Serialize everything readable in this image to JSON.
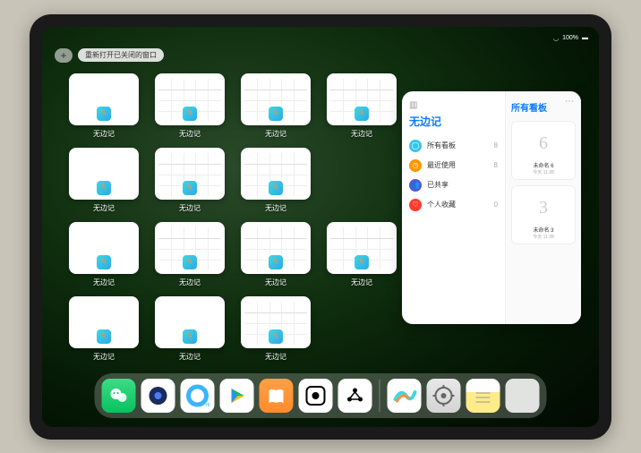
{
  "status": {
    "time": "",
    "battery": "100%",
    "wifi": "wifi"
  },
  "top": {
    "plus": "+",
    "reopen": "重新打开已关闭的窗口"
  },
  "windows": {
    "label": "无边记",
    "items": [
      {
        "style": "blank"
      },
      {
        "style": "cal"
      },
      {
        "style": "cal"
      },
      {
        "style": "cal"
      },
      {
        "style": "blank"
      },
      {
        "style": "cal"
      },
      {
        "style": "cal"
      },
      {
        "style": "blank"
      },
      {
        "style": "cal"
      },
      {
        "style": "cal"
      },
      {
        "style": "cal"
      },
      {
        "style": "blank"
      },
      {
        "style": "blank"
      },
      {
        "style": "cal"
      }
    ]
  },
  "panel": {
    "title": "无边记",
    "items": [
      {
        "icon": "ic-blue",
        "glyph": "◯",
        "label": "所有看板",
        "count": "8"
      },
      {
        "icon": "ic-orange",
        "glyph": "◷",
        "label": "最近使用",
        "count": "8"
      },
      {
        "icon": "ic-purple",
        "glyph": "👥",
        "label": "已共享",
        "count": ""
      },
      {
        "icon": "ic-red",
        "glyph": "♡",
        "label": "个人收藏",
        "count": "0"
      }
    ],
    "right_title": "所有看板",
    "boards": [
      {
        "sketch": "6",
        "label": "未命名 6",
        "date": "今天 11:28"
      },
      {
        "sketch": "3",
        "label": "未命名 3",
        "date": "今天 11:28"
      }
    ]
  },
  "dock": {
    "apps": [
      {
        "name": "wechat-icon"
      },
      {
        "name": "qq-dark-icon"
      },
      {
        "name": "qq-light-icon"
      },
      {
        "name": "play-icon"
      },
      {
        "name": "books-icon"
      },
      {
        "name": "dice-icon"
      },
      {
        "name": "cluster-icon"
      },
      {
        "name": "freeform-icon"
      },
      {
        "name": "settings-icon"
      },
      {
        "name": "notes-icon"
      },
      {
        "name": "app-library-icon"
      }
    ]
  }
}
